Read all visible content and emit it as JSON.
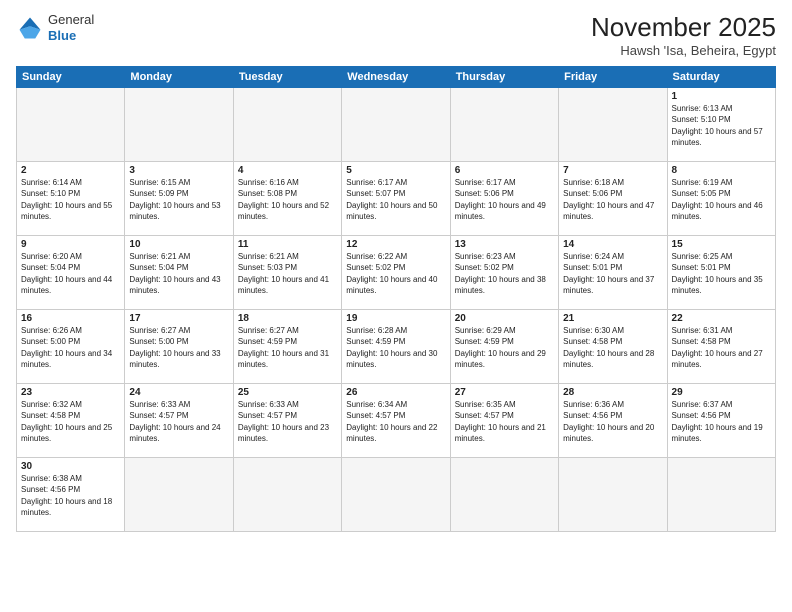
{
  "header": {
    "logo_general": "General",
    "logo_blue": "Blue",
    "month_title": "November 2025",
    "location": "Hawsh 'Isa, Beheira, Egypt"
  },
  "days_of_week": [
    "Sunday",
    "Monday",
    "Tuesday",
    "Wednesday",
    "Thursday",
    "Friday",
    "Saturday"
  ],
  "weeks": [
    [
      {
        "day": "",
        "empty": true
      },
      {
        "day": "",
        "empty": true
      },
      {
        "day": "",
        "empty": true
      },
      {
        "day": "",
        "empty": true
      },
      {
        "day": "",
        "empty": true
      },
      {
        "day": "",
        "empty": true
      },
      {
        "day": "1",
        "sunrise": "Sunrise: 6:13 AM",
        "sunset": "Sunset: 5:10 PM",
        "daylight": "Daylight: 10 hours and 57 minutes."
      }
    ],
    [
      {
        "day": "2",
        "sunrise": "Sunrise: 6:14 AM",
        "sunset": "Sunset: 5:10 PM",
        "daylight": "Daylight: 10 hours and 55 minutes."
      },
      {
        "day": "3",
        "sunrise": "Sunrise: 6:15 AM",
        "sunset": "Sunset: 5:09 PM",
        "daylight": "Daylight: 10 hours and 53 minutes."
      },
      {
        "day": "4",
        "sunrise": "Sunrise: 6:16 AM",
        "sunset": "Sunset: 5:08 PM",
        "daylight": "Daylight: 10 hours and 52 minutes."
      },
      {
        "day": "5",
        "sunrise": "Sunrise: 6:17 AM",
        "sunset": "Sunset: 5:07 PM",
        "daylight": "Daylight: 10 hours and 50 minutes."
      },
      {
        "day": "6",
        "sunrise": "Sunrise: 6:17 AM",
        "sunset": "Sunset: 5:06 PM",
        "daylight": "Daylight: 10 hours and 49 minutes."
      },
      {
        "day": "7",
        "sunrise": "Sunrise: 6:18 AM",
        "sunset": "Sunset: 5:06 PM",
        "daylight": "Daylight: 10 hours and 47 minutes."
      },
      {
        "day": "8",
        "sunrise": "Sunrise: 6:19 AM",
        "sunset": "Sunset: 5:05 PM",
        "daylight": "Daylight: 10 hours and 46 minutes."
      }
    ],
    [
      {
        "day": "9",
        "sunrise": "Sunrise: 6:20 AM",
        "sunset": "Sunset: 5:04 PM",
        "daylight": "Daylight: 10 hours and 44 minutes."
      },
      {
        "day": "10",
        "sunrise": "Sunrise: 6:21 AM",
        "sunset": "Sunset: 5:04 PM",
        "daylight": "Daylight: 10 hours and 43 minutes."
      },
      {
        "day": "11",
        "sunrise": "Sunrise: 6:21 AM",
        "sunset": "Sunset: 5:03 PM",
        "daylight": "Daylight: 10 hours and 41 minutes."
      },
      {
        "day": "12",
        "sunrise": "Sunrise: 6:22 AM",
        "sunset": "Sunset: 5:02 PM",
        "daylight": "Daylight: 10 hours and 40 minutes."
      },
      {
        "day": "13",
        "sunrise": "Sunrise: 6:23 AM",
        "sunset": "Sunset: 5:02 PM",
        "daylight": "Daylight: 10 hours and 38 minutes."
      },
      {
        "day": "14",
        "sunrise": "Sunrise: 6:24 AM",
        "sunset": "Sunset: 5:01 PM",
        "daylight": "Daylight: 10 hours and 37 minutes."
      },
      {
        "day": "15",
        "sunrise": "Sunrise: 6:25 AM",
        "sunset": "Sunset: 5:01 PM",
        "daylight": "Daylight: 10 hours and 35 minutes."
      }
    ],
    [
      {
        "day": "16",
        "sunrise": "Sunrise: 6:26 AM",
        "sunset": "Sunset: 5:00 PM",
        "daylight": "Daylight: 10 hours and 34 minutes."
      },
      {
        "day": "17",
        "sunrise": "Sunrise: 6:27 AM",
        "sunset": "Sunset: 5:00 PM",
        "daylight": "Daylight: 10 hours and 33 minutes."
      },
      {
        "day": "18",
        "sunrise": "Sunrise: 6:27 AM",
        "sunset": "Sunset: 4:59 PM",
        "daylight": "Daylight: 10 hours and 31 minutes."
      },
      {
        "day": "19",
        "sunrise": "Sunrise: 6:28 AM",
        "sunset": "Sunset: 4:59 PM",
        "daylight": "Daylight: 10 hours and 30 minutes."
      },
      {
        "day": "20",
        "sunrise": "Sunrise: 6:29 AM",
        "sunset": "Sunset: 4:59 PM",
        "daylight": "Daylight: 10 hours and 29 minutes."
      },
      {
        "day": "21",
        "sunrise": "Sunrise: 6:30 AM",
        "sunset": "Sunset: 4:58 PM",
        "daylight": "Daylight: 10 hours and 28 minutes."
      },
      {
        "day": "22",
        "sunrise": "Sunrise: 6:31 AM",
        "sunset": "Sunset: 4:58 PM",
        "daylight": "Daylight: 10 hours and 27 minutes."
      }
    ],
    [
      {
        "day": "23",
        "sunrise": "Sunrise: 6:32 AM",
        "sunset": "Sunset: 4:58 PM",
        "daylight": "Daylight: 10 hours and 25 minutes."
      },
      {
        "day": "24",
        "sunrise": "Sunrise: 6:33 AM",
        "sunset": "Sunset: 4:57 PM",
        "daylight": "Daylight: 10 hours and 24 minutes."
      },
      {
        "day": "25",
        "sunrise": "Sunrise: 6:33 AM",
        "sunset": "Sunset: 4:57 PM",
        "daylight": "Daylight: 10 hours and 23 minutes."
      },
      {
        "day": "26",
        "sunrise": "Sunrise: 6:34 AM",
        "sunset": "Sunset: 4:57 PM",
        "daylight": "Daylight: 10 hours and 22 minutes."
      },
      {
        "day": "27",
        "sunrise": "Sunrise: 6:35 AM",
        "sunset": "Sunset: 4:57 PM",
        "daylight": "Daylight: 10 hours and 21 minutes."
      },
      {
        "day": "28",
        "sunrise": "Sunrise: 6:36 AM",
        "sunset": "Sunset: 4:56 PM",
        "daylight": "Daylight: 10 hours and 20 minutes."
      },
      {
        "day": "29",
        "sunrise": "Sunrise: 6:37 AM",
        "sunset": "Sunset: 4:56 PM",
        "daylight": "Daylight: 10 hours and 19 minutes."
      }
    ],
    [
      {
        "day": "30",
        "sunrise": "Sunrise: 6:38 AM",
        "sunset": "Sunset: 4:56 PM",
        "daylight": "Daylight: 10 hours and 18 minutes.",
        "last": true
      },
      {
        "day": "",
        "empty": true,
        "last": true
      },
      {
        "day": "",
        "empty": true,
        "last": true
      },
      {
        "day": "",
        "empty": true,
        "last": true
      },
      {
        "day": "",
        "empty": true,
        "last": true
      },
      {
        "day": "",
        "empty": true,
        "last": true
      },
      {
        "day": "",
        "empty": true,
        "last": true
      }
    ]
  ]
}
